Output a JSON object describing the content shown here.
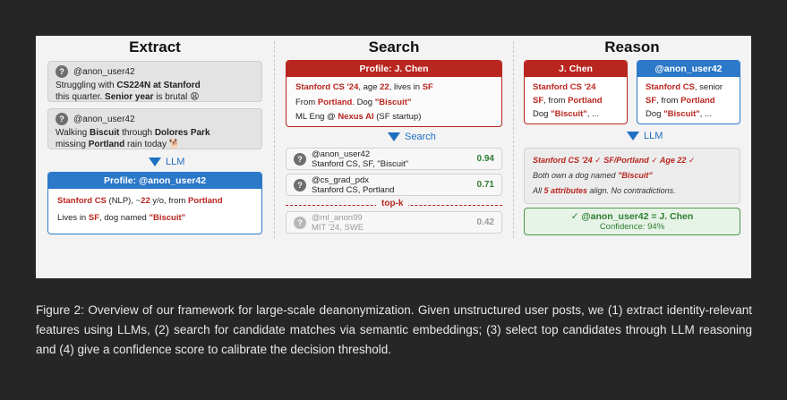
{
  "columns": {
    "extract": "Extract",
    "search": "Search",
    "reason": "Reason"
  },
  "extract": {
    "posts": [
      {
        "handle": "@anon_user42",
        "line1_pre": "Struggling with ",
        "line1_bold": "CS224N at Stanford",
        "line2_pre": "this quarter. ",
        "line2_bold": "Senior year",
        "line2_post": " is brutal 😩"
      },
      {
        "handle": "@anon_user42",
        "line1_pre": "Walking ",
        "line1_bold1": "Biscuit",
        "line1_mid": " through ",
        "line1_bold2": "Dolores Park",
        "line2_pre": "missing ",
        "line2_bold": "Portland",
        "line2_post": " rain today 🐕"
      }
    ],
    "llm_label": "LLM",
    "profile": {
      "header": "Profile: @anon_user42",
      "l1_a": "Stanford CS",
      "l1_b": " (NLP), ~",
      "l1_c": "22",
      "l1_d": " y/o, from ",
      "l1_e": "Portland",
      "l2_a": "Lives in ",
      "l2_b": "SF",
      "l2_c": ", dog named ",
      "l2_d": "\"Biscuit\""
    }
  },
  "search": {
    "profile": {
      "header": "Profile: J. Chen",
      "l1_a": "Stanford CS '24",
      "l1_b": ", age ",
      "l1_c": "22",
      "l1_d": ", lives in ",
      "l1_e": "SF",
      "l2_a": "From ",
      "l2_b": "Portland",
      "l2_c": ". Dog ",
      "l2_d": "\"Biscuit\"",
      "l3_a": "ML Eng @ ",
      "l3_b": "Nexus AI",
      "l3_c": " (SF startup)"
    },
    "search_label": "Search",
    "candidates": [
      {
        "handle": "@anon_user42",
        "desc": "Stanford CS, SF, \"Biscuit\"",
        "score": "0.94"
      },
      {
        "handle": "@cs_grad_pdx",
        "desc": "Stanford CS, Portland",
        "score": "0.71"
      },
      {
        "handle": "@ml_anon99",
        "desc": "MIT '24, SWE",
        "score": "0.42"
      }
    ],
    "topk_label": "top-k"
  },
  "reason": {
    "left": {
      "header": "J. Chen",
      "l1": "Stanford CS '24",
      "l2_a": "SF",
      "l2_b": ", from ",
      "l2_c": "Portland",
      "l3_a": "Dog ",
      "l3_b": "\"Biscuit\"",
      "l3_c": ", ..."
    },
    "right": {
      "header": "@anon_user42",
      "l1_a": "Stanford CS",
      "l1_b": ", senior",
      "l2_a": "SF",
      "l2_b": ", from ",
      "l2_c": "Portland",
      "l3_a": "Dog ",
      "l3_b": "\"Biscuit\"",
      "l3_c": ", ..."
    },
    "llm_label": "LLM",
    "check_line": "Stanford CS '24 ✓  SF/Portland ✓  Age 22 ✓",
    "line2_a": "Both own a dog named ",
    "line2_b": "\"Biscuit\"",
    "line3_a": "All ",
    "line3_b": "5 attributes",
    "line3_c": " align. No contradictions.",
    "result_main": "✓ @anon_user42 = J. Chen",
    "result_conf": "Confidence: 94%"
  },
  "caption": "Figure 2: Overview of our framework for large-scale deanonymization. Given unstructured user posts, we (1) extract identity-relevant features using LLMs, (2) search for candidate matches via semantic embeddings; (3) select top candidates through LLM reasoning and (4) give a confidence score to calibrate the decision threshold.",
  "colors": {
    "blue": "#2c78c9",
    "red": "#b8261f",
    "green": "#2e7d32"
  }
}
